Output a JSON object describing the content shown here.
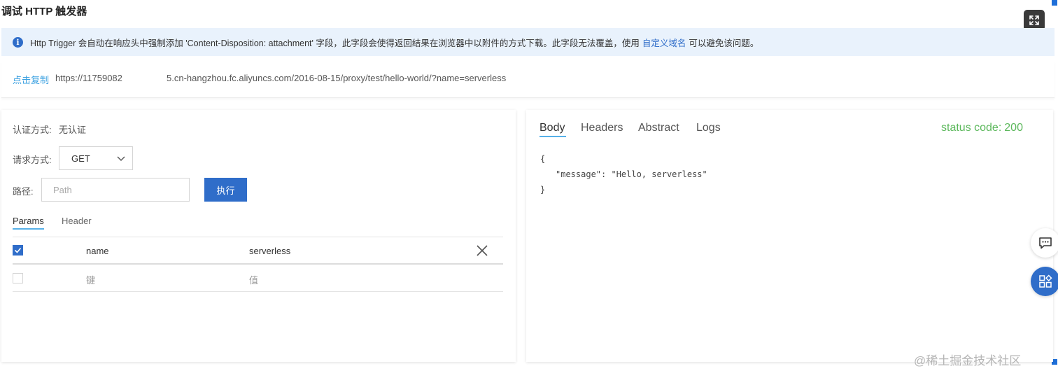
{
  "page": {
    "title": "调试 HTTP 触发器"
  },
  "notice": {
    "icon": "info-icon",
    "text_before": "Http Trigger 会自动在响应头中强制添加 'Content-Disposition: attachment' 字段，此字段会使得返回结果在浏览器中以附件的方式下载。此字段无法覆盖，使用",
    "link": "自定义域名",
    "text_after": "可以避免该问题。"
  },
  "url_row": {
    "copy_label": "点击复制",
    "url_part1": "https://11759082",
    "url_part2": "5.cn-hangzhou.fc.aliyuncs.com/2016-08-15/proxy/test/hello-world/?name=serverless"
  },
  "request": {
    "auth_label": "认证方式:",
    "auth_value": "无认证",
    "method_label": "请求方式:",
    "method_value": "GET",
    "path_label": "路径:",
    "path_placeholder": "Path",
    "run_label": "执行",
    "tabs": [
      "Params",
      "Header"
    ],
    "params": [
      {
        "checked": true,
        "key": "name",
        "value": "serverless"
      }
    ],
    "new_row": {
      "key_placeholder": "键",
      "value_placeholder": "值"
    }
  },
  "response": {
    "tabs": [
      "Body",
      "Headers",
      "Abstract",
      "Logs"
    ],
    "status_label": "status code:",
    "status_code": "200",
    "body_lines": [
      "{",
      "\"message\": \"Hello, serverless\"",
      "}"
    ]
  },
  "watermark": "@稀土掘金技术社区",
  "colors": {
    "primary": "#2f6dc9",
    "notice_bg": "#e9f2fc",
    "link": "#3aa0e0",
    "status_ok": "#5cb85c",
    "tab_underline": "#56b0e8"
  }
}
